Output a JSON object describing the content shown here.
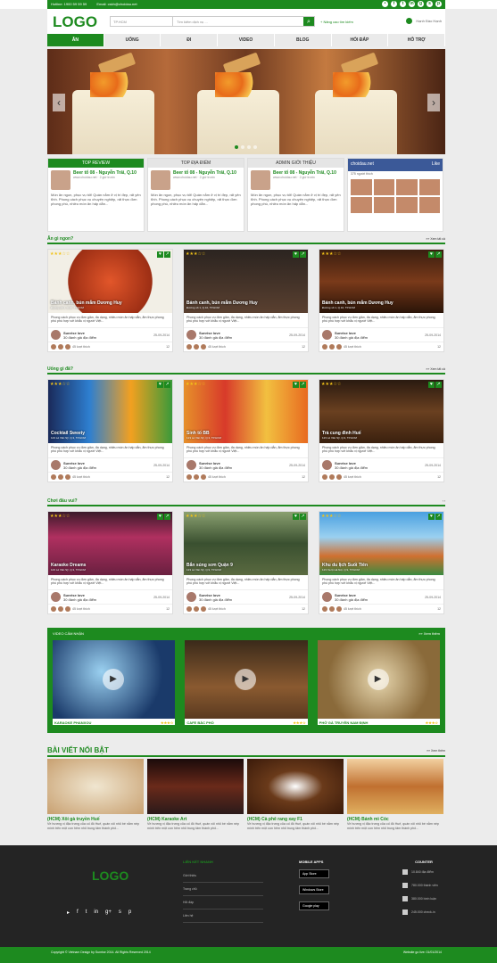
{
  "topbar": {
    "hotline": "Hotline: 1900 59 59 59",
    "email": "Email: cskh@choidau.net"
  },
  "header": {
    "logo": "LOGO",
    "location": "TP.HCM",
    "search_placeholder": "Tìm kiếm dịch vụ ...",
    "advanced": "+ Nâng cao tìm kiếm",
    "user": "Hạnh Đào Hạnh"
  },
  "nav": [
    "ĂN",
    "UỐNG",
    "ĐI",
    "VIDEO",
    "BLOG",
    "HỎI ĐÁP",
    "HỖ TRỢ"
  ],
  "reviews": {
    "tabs": [
      "TOP REVIEW",
      "TOP ĐỊA ĐIỂM",
      "ADMIN GIỚI THIỆU"
    ],
    "item_title": "Beer tổ 08 - Nguyễn Trãi, Q.10",
    "item_meta": "www.choidau.net · 2 giờ trước",
    "item_desc": "Món ăn ngon, phục vụ tốt! Quán nằm ở vị trí đẹp, rất yên tĩnh. Phong cách phục vụ chuyên nghiệp, rất thực đơn phong phú, nhiều món ăn hấp dẫn...",
    "fb_title": "choidau.net",
    "fb_like": "Like",
    "fb_count": "375 người thích"
  },
  "sections": [
    {
      "title": "Ăn gì ngon?",
      "more": "»» Xem tất cả",
      "cards": [
        {
          "cap": "Bánh canh, bún mắm Dương Huy",
          "addr": "Đường số 1, Q.10, TP.HCM"
        },
        {
          "cap": "Bánh canh, bún mắm Dương Huy",
          "addr": "Đường số 1, Q.10, TP.HCM"
        },
        {
          "cap": "Bánh canh, bún mắm Dương Huy",
          "addr": "Đường số 1, Q.10, TP.HCM"
        }
      ]
    },
    {
      "title": "Uống gì đã?",
      "more": "»» Xem tất cả",
      "cards": [
        {
          "cap": "Cocktail Sweety",
          "addr": "123 Lê Văn Sỹ, Q.3, TP.HCM"
        },
        {
          "cap": "Sinh tố BB",
          "addr": "123 Lê Văn Sỹ, Q.3, TP.HCM"
        },
        {
          "cap": "Trà cung đình Huế",
          "addr": "123 Lê Văn Sỹ, Q.3, TP.HCM"
        }
      ]
    },
    {
      "title": "Chơi đâu vui?",
      "more": "",
      "cards": [
        {
          "cap": "Karaoke Dreams",
          "addr": "123 Lê Văn Sỹ, Q.3, TP.HCM"
        },
        {
          "cap": "Bắn súng sơn Quận 9",
          "addr": "123 Lê Văn Sỹ, Q.9, TP.HCM"
        },
        {
          "cap": "Khu du lịch Suối Tiên",
          "addr": "123 Xa lộ Hà Nội, Q.9, TP.HCM"
        }
      ]
    }
  ],
  "card_common": {
    "desc": "Phong cách phục vụ đơn giản, đa dạng, nhiều món ăn hấp dẫn, ẩm thực phong phú phù hợp với khẩu vị người Việt...",
    "user": "Sunrise love",
    "user_sub": "30 đánh giá địa điểm",
    "date": "25-09-2014",
    "foot": "45 lượt thích",
    "comments": "12"
  },
  "video": {
    "title": "VIDEO CẢM NHẬN",
    "more": "»» Xem thêm",
    "items": [
      "KARAOKE PHANXOU",
      "CAFE BẮC PHỐ",
      "PHỞ GÀ TRUYỀN NAM ĐỊNH"
    ]
  },
  "featured": {
    "title": "BÀI VIẾT NỔI BẬT",
    "more": "»» Xem thêm",
    "items": [
      {
        "t": "(HCM) Xôi gà truyền Huế"
      },
      {
        "t": "(HCM) Karaoke Art"
      },
      {
        "t": "(HCM) Cà phê rang xay F1"
      },
      {
        "t": "(HCM) Bánh mì Cóc"
      }
    ],
    "desc": "Về hương vị đặc trưng của cố đô Huế, quán xôi nhỏ bé nằm nép mình trên một con hẻm nhỏ trung tâm thành phố..."
  },
  "footer": {
    "logo": "LOGO",
    "links_title": "LIÊN KẾT NHANH",
    "links": [
      "Giới thiệu",
      "Trang chủ",
      "Hỏi đáp",
      "Liên hệ"
    ],
    "apps_title": "MOBILE APPS",
    "apps": [
      "App Store",
      "Windows Store",
      "Google play"
    ],
    "counter_title": "COUNTER",
    "counter": [
      "10.840 địa điểm",
      "780.000 thành viên",
      "380.000 bình luận",
      "245.000 check-in"
    ]
  },
  "bottom": {
    "left": "Copyright © Vietnam Design by Sunrise 2014. All Rights Reserved 2014",
    "right": "Website go live: 01/01/2014"
  },
  "colors": {
    "brand": "#1d8a1f"
  }
}
